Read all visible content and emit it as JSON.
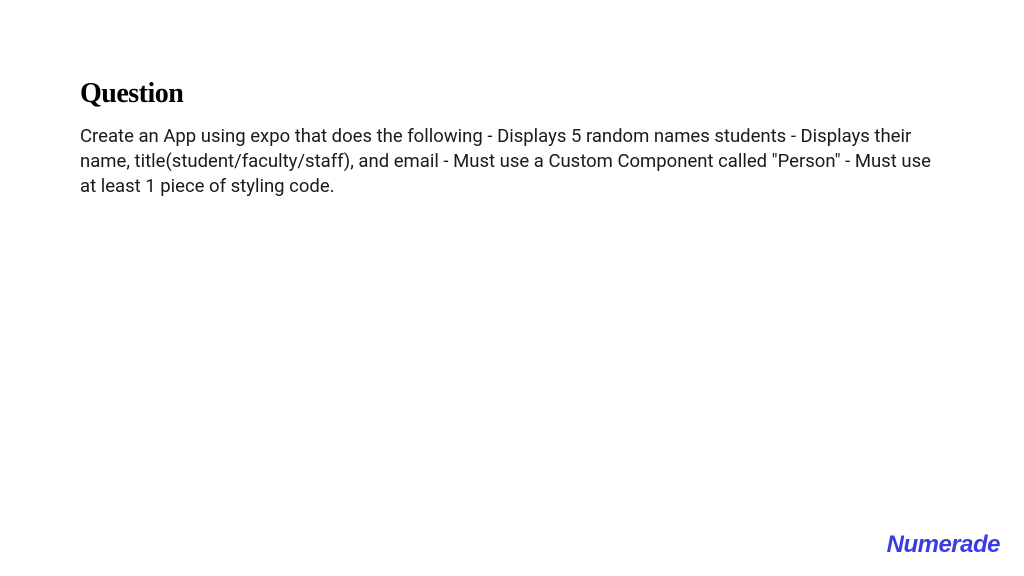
{
  "heading": "Question",
  "body": "Create an App using expo that does the following - Displays 5 random names students - Displays their name, title(student/faculty/staff), and email - Must use a Custom Component called \"Person\" - Must use at least 1 piece of styling code.",
  "brand": "Numerade"
}
